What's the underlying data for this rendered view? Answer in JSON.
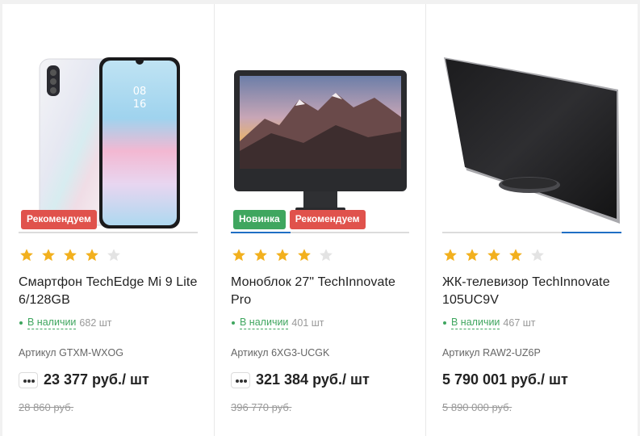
{
  "products": [
    {
      "badges": [
        {
          "label": "Рекомендуем",
          "type": "rec"
        }
      ],
      "rating": 4,
      "title": "Смартфон TechEdge Mi 9 Lite 6/128GB",
      "stock_label": "В наличии",
      "stock_qty": "682 шт",
      "sku": "Артикул GTXM-WXOG",
      "price": "23 377 руб./ шт",
      "old_price": "28 860 руб.",
      "has_more": true
    },
    {
      "badges": [
        {
          "label": "Новинка",
          "type": "new"
        },
        {
          "label": "Рекомендуем",
          "type": "rec"
        }
      ],
      "rating": 4,
      "title": "Моноблок 27\" TechInnovate Pro",
      "stock_label": "В наличии",
      "stock_qty": "401 шт",
      "sku": "Артикул 6XG3-UCGK",
      "price": "321 384 руб./ шт",
      "old_price": "396 770 руб.",
      "has_more": true
    },
    {
      "badges": [],
      "rating": 4,
      "title": "ЖК-телевизор TechInnovate 105UC9V",
      "stock_label": "В наличии",
      "stock_qty": "467 шт",
      "sku": "Артикул RAW2-UZ6P",
      "price": "5 790 001 руб./ шт",
      "old_price": "5 890 000 руб.",
      "has_more": false
    }
  ],
  "colors": {
    "star_on": "#f2b01e",
    "star_off": "#e3e3e3",
    "accent": "#1f6fc4",
    "green": "#3fa65f",
    "red": "#e0524c"
  }
}
